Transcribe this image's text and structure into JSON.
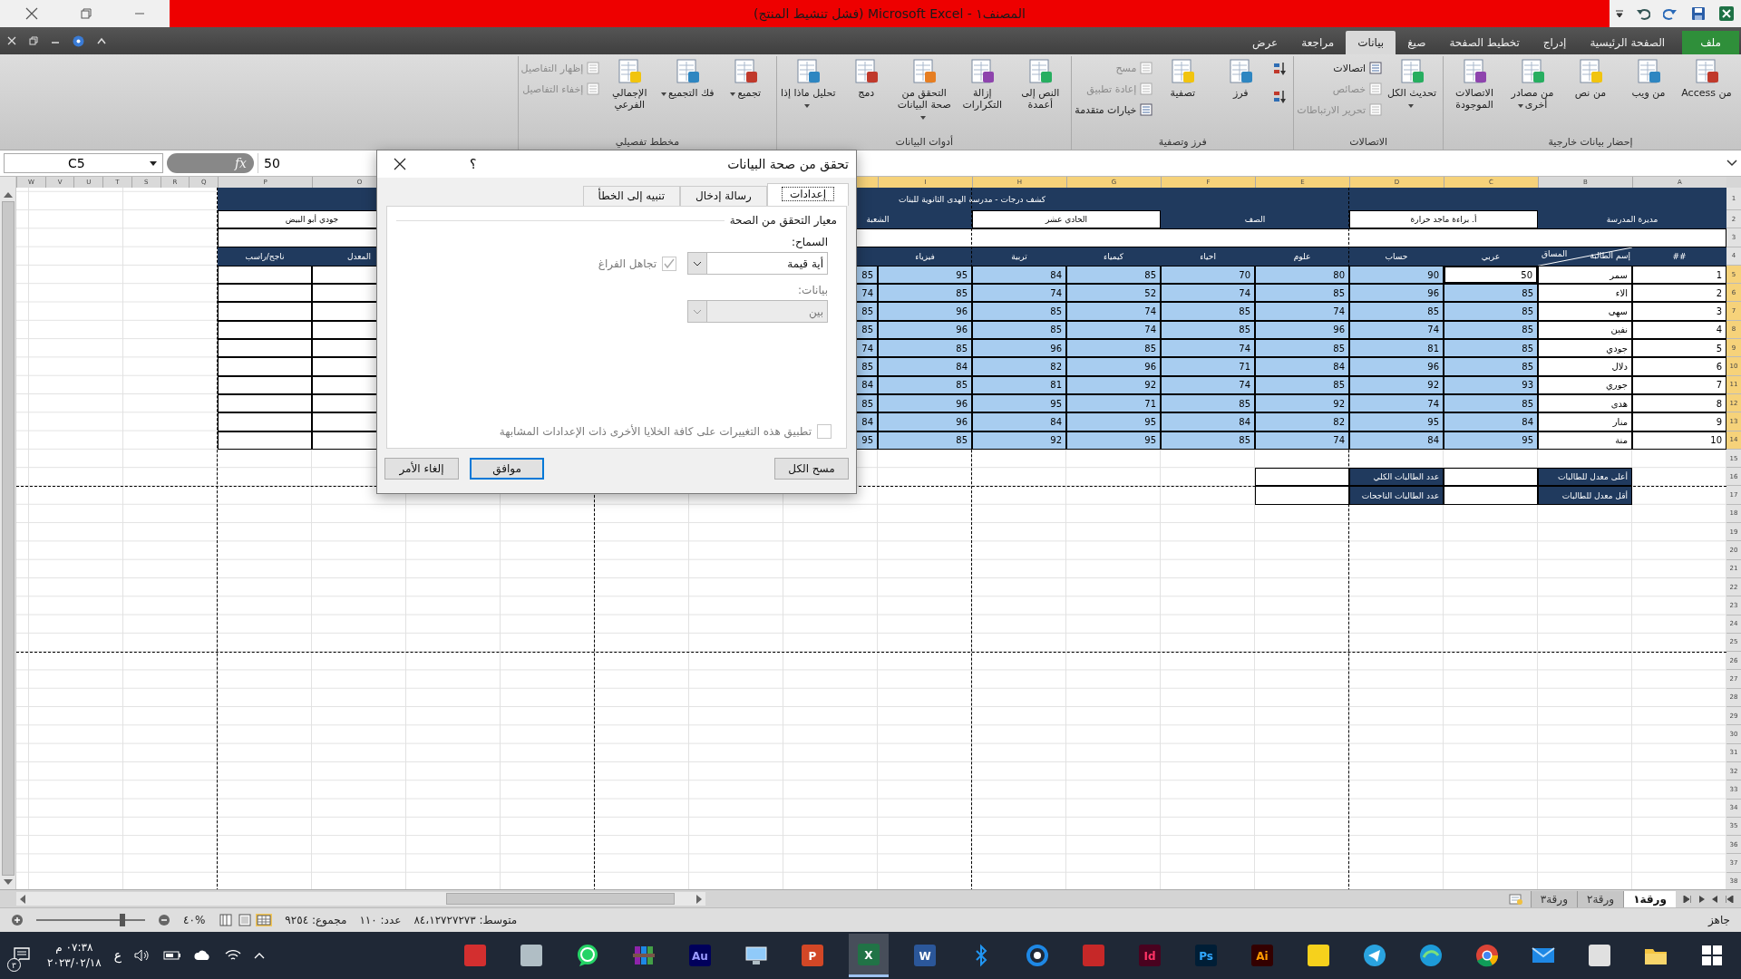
{
  "window": {
    "title": "المصنف١ - Microsoft Excel (فشل تنشيط المنتج)"
  },
  "ribbon_tabs": [
    {
      "label": "ملف",
      "kind": "file",
      "selected": false
    },
    {
      "label": "الصفحة الرئيسية",
      "kind": "tab",
      "selected": false
    },
    {
      "label": "إدراج",
      "kind": "tab",
      "selected": false
    },
    {
      "label": "تخطيط الصفحة",
      "kind": "tab",
      "selected": false
    },
    {
      "label": "صيغ",
      "kind": "tab",
      "selected": false
    },
    {
      "label": "بيانات",
      "kind": "tab",
      "selected": true
    },
    {
      "label": "مراجعة",
      "kind": "tab",
      "selected": false
    },
    {
      "label": "عرض",
      "kind": "tab",
      "selected": false
    }
  ],
  "ribbon_groups": [
    {
      "label": "إحضار بيانات خارجية",
      "buttons": [
        {
          "label": "من Access",
          "kind": "large",
          "dropdown": false,
          "disabled": false
        },
        {
          "label": "من ويب",
          "kind": "large",
          "dropdown": false,
          "disabled": false
        },
        {
          "label": "من نص",
          "kind": "large",
          "dropdown": false,
          "disabled": false
        },
        {
          "label": "من مصادر أخرى",
          "kind": "large",
          "dropdown": true,
          "disabled": false
        },
        {
          "label": "الاتصالات الموجودة",
          "kind": "large",
          "dropdown": false,
          "disabled": false
        }
      ]
    },
    {
      "label": "الاتصالات",
      "buttons": [
        {
          "label": "تحديث الكل",
          "kind": "large",
          "dropdown": true,
          "disabled": false
        },
        {
          "label": "اتصالات",
          "kind": "small",
          "dropdown": false,
          "disabled": false
        },
        {
          "label": "خصائص",
          "kind": "small",
          "dropdown": false,
          "disabled": true
        },
        {
          "label": "تحرير الارتباطات",
          "kind": "small",
          "dropdown": false,
          "disabled": true
        }
      ]
    },
    {
      "label": "فرز وتصفية",
      "buttons": [
        {
          "kind": "icon"
        },
        {
          "kind": "icon"
        },
        {
          "label": "فرز",
          "kind": "large",
          "dropdown": false,
          "disabled": false
        },
        {
          "label": "تصفية",
          "kind": "large",
          "dropdown": false,
          "disabled": false
        },
        {
          "label": "مسح",
          "kind": "small",
          "dropdown": false,
          "disabled": true
        },
        {
          "label": "إعادة تطبيق",
          "kind": "small",
          "dropdown": false,
          "disabled": true
        },
        {
          "label": "خيارات متقدمة",
          "kind": "small",
          "dropdown": false,
          "disabled": false
        }
      ]
    },
    {
      "label": "أدوات البيانات",
      "buttons": [
        {
          "label": "النص إلى أعمدة",
          "kind": "large",
          "dropdown": false,
          "disabled": false
        },
        {
          "label": "إزالة التكرارات",
          "kind": "large",
          "dropdown": false,
          "disabled": false
        },
        {
          "label": "التحقق من صحة البيانات",
          "kind": "large",
          "dropdown": true,
          "disabled": false
        },
        {
          "label": "دمج",
          "kind": "large",
          "dropdown": false,
          "disabled": false
        },
        {
          "label": "تحليل ماذا إذا",
          "kind": "large",
          "dropdown": true,
          "disabled": false
        }
      ]
    },
    {
      "label": "مخطط تفصيلي",
      "buttons": [
        {
          "label": "تجميع",
          "kind": "large",
          "dropdown": true,
          "disabled": false
        },
        {
          "label": "فك التجميع",
          "kind": "large",
          "dropdown": true,
          "disabled": false
        },
        {
          "label": "الإجمالي الفرعي",
          "kind": "large",
          "dropdown": false,
          "disabled": false
        },
        {
          "label": "إظهار التفاصيل",
          "kind": "small",
          "dropdown": false,
          "disabled": true
        },
        {
          "label": "إخفاء التفاصيل",
          "kind": "small",
          "dropdown": false,
          "disabled": true
        }
      ]
    }
  ],
  "formula_bar": {
    "name_box": "C5",
    "function_button": "fx",
    "value": "50"
  },
  "sheet": {
    "columns": [
      {
        "letter": "A",
        "selected": false
      },
      {
        "letter": "B",
        "selected": false
      },
      {
        "letter": "C",
        "selected": true
      },
      {
        "letter": "D",
        "selected": true
      },
      {
        "letter": "E",
        "selected": true
      },
      {
        "letter": "F",
        "selected": true
      },
      {
        "letter": "G",
        "selected": true
      },
      {
        "letter": "H",
        "selected": true
      },
      {
        "letter": "I",
        "selected": true
      },
      {
        "selected": true
      },
      {
        "letter": "O",
        "selected": false
      },
      {
        "letter": "P",
        "selected": false
      },
      {
        "letter": "Q",
        "selected": false
      },
      {
        "letter": "R",
        "selected": false
      },
      {
        "letter": "S",
        "selected": false
      },
      {
        "letter": "T",
        "selected": false
      },
      {
        "letter": "U",
        "selected": false
      },
      {
        "letter": "V",
        "selected": false
      },
      {
        "letter": "W",
        "selected": false
      }
    ],
    "rows": [
      {
        "number": "1",
        "selected": false,
        "cells": [
          {
            "kind": "band"
          },
          {
            "kind": "band",
            "text": "كشف درجات - مدرسة الهدى الثانوية للبنات"
          },
          {
            "kind": "band"
          }
        ]
      },
      {
        "number": "2",
        "selected": false,
        "cells": [
          {
            "kind": "band",
            "text": "مديرة المدرسة"
          },
          {
            "kind": "field",
            "text": "أ. براءة ماجد حرارة"
          },
          {
            "kind": "band",
            "text": "الصف"
          },
          {
            "kind": "field",
            "text": "الحادي عشر"
          },
          {
            "kind": "band",
            "text": "الشعبة"
          },
          {
            "kind": "field",
            "text": "جودي أبو البيض"
          }
        ]
      },
      {
        "number": "3",
        "selected": false,
        "cells": [
          {
            "kind": "field"
          }
        ]
      },
      {
        "number": "4",
        "selected": false,
        "cells": [
          {
            "kind": "band",
            "text": "##"
          },
          {
            "kind": "diag",
            "text": "إسم الطالبة",
            "text2": "المساق"
          },
          {
            "kind": "band",
            "text": "عربي"
          },
          {
            "kind": "band",
            "text": "حساب"
          },
          {
            "kind": "band",
            "text": "علوم"
          },
          {
            "kind": "band",
            "text": "احياء"
          },
          {
            "kind": "band",
            "text": "كيمياء"
          },
          {
            "kind": "band",
            "text": "تربية"
          },
          {
            "kind": "band",
            "text": "فيزياء"
          },
          {
            "kind": "band"
          },
          {
            "kind": "band",
            "text": "المعدل"
          },
          {
            "kind": "band",
            "text": "ناجح/راسب"
          }
        ]
      },
      {
        "number": "5",
        "selected": true,
        "cells": [
          {
            "kind": "index",
            "text": "1"
          },
          {
            "kind": "name",
            "text": "سمر"
          },
          {
            "kind": "value",
            "text": "50",
            "active": true
          },
          {
            "kind": "value",
            "text": "90",
            "selected": true,
            "active": false
          },
          {
            "kind": "value",
            "text": "80",
            "selected": true,
            "active": false
          },
          {
            "kind": "value",
            "text": "70",
            "selected": true,
            "active": false
          },
          {
            "kind": "value",
            "text": "85",
            "selected": true,
            "active": false
          },
          {
            "kind": "value",
            "text": "84",
            "selected": true,
            "active": false
          },
          {
            "kind": "value",
            "text": "95",
            "selected": true,
            "active": false
          },
          {
            "kind": "value",
            "text": "85",
            "selected": true,
            "active": false
          },
          {
            "kind": "field"
          },
          {
            "kind": "field"
          }
        ]
      },
      {
        "number": "6",
        "selected": true,
        "cells": [
          {
            "kind": "index",
            "text": "2"
          },
          {
            "kind": "name",
            "text": "الاء"
          },
          {
            "kind": "value",
            "text": "85",
            "selected": true,
            "active": false
          },
          {
            "kind": "value",
            "text": "96",
            "selected": true,
            "active": false
          },
          {
            "kind": "value",
            "text": "85",
            "selected": true,
            "active": false
          },
          {
            "kind": "value",
            "text": "74",
            "selected": true,
            "active": false
          },
          {
            "kind": "value",
            "text": "52",
            "selected": true,
            "active": false
          },
          {
            "kind": "value",
            "text": "74",
            "selected": true,
            "active": false
          },
          {
            "kind": "value",
            "text": "85",
            "selected": true,
            "active": false
          },
          {
            "kind": "value",
            "text": "74",
            "selected": true,
            "active": false
          },
          {
            "kind": "field"
          },
          {
            "kind": "field"
          }
        ]
      },
      {
        "number": "7",
        "selected": true,
        "cells": [
          {
            "kind": "index",
            "text": "3"
          },
          {
            "kind": "name",
            "text": "سهى"
          },
          {
            "kind": "value",
            "text": "85",
            "selected": true,
            "active": false
          },
          {
            "kind": "value",
            "text": "85",
            "selected": true,
            "active": false
          },
          {
            "kind": "value",
            "text": "74",
            "selected": true,
            "active": false
          },
          {
            "kind": "value",
            "text": "85",
            "selected": true,
            "active": false
          },
          {
            "kind": "value",
            "text": "74",
            "selected": true,
            "active": false
          },
          {
            "kind": "value",
            "text": "85",
            "selected": true,
            "active": false
          },
          {
            "kind": "value",
            "text": "96",
            "selected": true,
            "active": false
          },
          {
            "kind": "value",
            "text": "85",
            "selected": true,
            "active": false
          },
          {
            "kind": "field"
          },
          {
            "kind": "field"
          }
        ]
      },
      {
        "number": "8",
        "selected": true,
        "cells": [
          {
            "kind": "index",
            "text": "4"
          },
          {
            "kind": "name",
            "text": "نفين"
          },
          {
            "kind": "value",
            "text": "85",
            "selected": true,
            "active": false
          },
          {
            "kind": "value",
            "text": "74",
            "selected": true,
            "active": false
          },
          {
            "kind": "value",
            "text": "96",
            "selected": true,
            "active": false
          },
          {
            "kind": "value",
            "text": "85",
            "selected": true,
            "active": false
          },
          {
            "kind": "value",
            "text": "74",
            "selected": true,
            "active": false
          },
          {
            "kind": "value",
            "text": "85",
            "selected": true,
            "active": false
          },
          {
            "kind": "value",
            "text": "96",
            "selected": true,
            "active": false
          },
          {
            "kind": "value",
            "text": "85",
            "selected": true,
            "active": false
          },
          {
            "kind": "field"
          },
          {
            "kind": "field"
          }
        ]
      },
      {
        "number": "9",
        "selected": true,
        "cells": [
          {
            "kind": "index",
            "text": "5"
          },
          {
            "kind": "name",
            "text": "جودي"
          },
          {
            "kind": "value",
            "text": "85",
            "selected": true,
            "active": false
          },
          {
            "kind": "value",
            "text": "81",
            "selected": true,
            "active": false
          },
          {
            "kind": "value",
            "text": "85",
            "selected": true,
            "active": false
          },
          {
            "kind": "value",
            "text": "74",
            "selected": true,
            "active": false
          },
          {
            "kind": "value",
            "text": "85",
            "selected": true,
            "active": false
          },
          {
            "kind": "value",
            "text": "96",
            "selected": true,
            "active": false
          },
          {
            "kind": "value",
            "text": "85",
            "selected": true,
            "active": false
          },
          {
            "kind": "value",
            "text": "74",
            "selected": true,
            "active": false
          },
          {
            "kind": "field"
          },
          {
            "kind": "field"
          }
        ]
      },
      {
        "number": "10",
        "selected": true,
        "cells": [
          {
            "kind": "index",
            "text": "6"
          },
          {
            "kind": "name",
            "text": "دلال"
          },
          {
            "kind": "value",
            "text": "85",
            "selected": true,
            "active": false
          },
          {
            "kind": "value",
            "text": "96",
            "selected": true,
            "active": false
          },
          {
            "kind": "value",
            "text": "84",
            "selected": true,
            "active": false
          },
          {
            "kind": "value",
            "text": "71",
            "selected": true,
            "active": false
          },
          {
            "kind": "value",
            "text": "96",
            "selected": true,
            "active": false
          },
          {
            "kind": "value",
            "text": "82",
            "selected": true,
            "active": false
          },
          {
            "kind": "value",
            "text": "84",
            "selected": true,
            "active": false
          },
          {
            "kind": "value",
            "text": "85",
            "selected": true,
            "active": false
          },
          {
            "kind": "field"
          },
          {
            "kind": "field"
          }
        ]
      },
      {
        "number": "11",
        "selected": true,
        "cells": [
          {
            "kind": "index",
            "text": "7"
          },
          {
            "kind": "name",
            "text": "جوري"
          },
          {
            "kind": "value",
            "text": "93",
            "selected": true,
            "active": false
          },
          {
            "kind": "value",
            "text": "92",
            "selected": true,
            "active": false
          },
          {
            "kind": "value",
            "text": "85",
            "selected": true,
            "active": false
          },
          {
            "kind": "value",
            "text": "74",
            "selected": true,
            "active": false
          },
          {
            "kind": "value",
            "text": "92",
            "selected": true,
            "active": false
          },
          {
            "kind": "value",
            "text": "81",
            "selected": true,
            "active": false
          },
          {
            "kind": "value",
            "text": "85",
            "selected": true,
            "active": false
          },
          {
            "kind": "value",
            "text": "84",
            "selected": true,
            "active": false
          },
          {
            "kind": "field"
          },
          {
            "kind": "field"
          }
        ]
      },
      {
        "number": "12",
        "selected": true,
        "cells": [
          {
            "kind": "index",
            "text": "8"
          },
          {
            "kind": "name",
            "text": "هدى"
          },
          {
            "kind": "value",
            "text": "85",
            "selected": true,
            "active": false
          },
          {
            "kind": "value",
            "text": "74",
            "selected": true,
            "active": false
          },
          {
            "kind": "value",
            "text": "92",
            "selected": true,
            "active": false
          },
          {
            "kind": "value",
            "text": "85",
            "selected": true,
            "active": false
          },
          {
            "kind": "value",
            "text": "71",
            "selected": true,
            "active": false
          },
          {
            "kind": "value",
            "text": "95",
            "selected": true,
            "active": false
          },
          {
            "kind": "value",
            "text": "96",
            "selected": true,
            "active": false
          },
          {
            "kind": "value",
            "text": "85",
            "selected": true,
            "active": false
          },
          {
            "kind": "field"
          },
          {
            "kind": "field"
          }
        ]
      },
      {
        "number": "13",
        "selected": true,
        "cells": [
          {
            "kind": "index",
            "text": "9"
          },
          {
            "kind": "name",
            "text": "منار"
          },
          {
            "kind": "value",
            "text": "84",
            "selected": true,
            "active": false
          },
          {
            "kind": "value",
            "text": "95",
            "selected": true,
            "active": false
          },
          {
            "kind": "value",
            "text": "82",
            "selected": true,
            "active": false
          },
          {
            "kind": "value",
            "text": "84",
            "selected": true,
            "active": false
          },
          {
            "kind": "value",
            "text": "95",
            "selected": true,
            "active": false
          },
          {
            "kind": "value",
            "text": "84",
            "selected": true,
            "active": false
          },
          {
            "kind": "value",
            "text": "96",
            "selected": true,
            "active": false
          },
          {
            "kind": "value",
            "text": "84",
            "selected": true,
            "active": false
          },
          {
            "kind": "field"
          },
          {
            "kind": "field"
          }
        ]
      },
      {
        "number": "14",
        "selected": true,
        "cells": [
          {
            "kind": "index",
            "text": "10"
          },
          {
            "kind": "name",
            "text": "منة"
          },
          {
            "kind": "value",
            "text": "95",
            "selected": true,
            "active": false
          },
          {
            "kind": "value",
            "text": "84",
            "selected": true,
            "active": false
          },
          {
            "kind": "value",
            "text": "74",
            "selected": true,
            "active": false
          },
          {
            "kind": "value",
            "text": "85",
            "selected": true,
            "active": false
          },
          {
            "kind": "value",
            "text": "95",
            "selected": true,
            "active": false
          },
          {
            "kind": "value",
            "text": "92",
            "selected": true,
            "active": false
          },
          {
            "kind": "value",
            "text": "85",
            "selected": true,
            "active": false
          },
          {
            "kind": "value",
            "text": "95",
            "selected": true,
            "active": false
          },
          {
            "kind": "field"
          },
          {
            "kind": "field"
          }
        ]
      },
      {
        "number": "15",
        "selected": false
      },
      {
        "number": "16",
        "selected": false,
        "cells": [
          {
            "kind": "plain"
          },
          {
            "kind": "summary",
            "text": "أعلى معدل للطالبات"
          },
          {
            "kind": "field"
          },
          {
            "kind": "summary",
            "text": "عدد الطالبات الكلي"
          },
          {
            "kind": "field"
          }
        ]
      },
      {
        "number": "17",
        "selected": false,
        "cells": [
          {
            "kind": "plain"
          },
          {
            "kind": "summary",
            "text": "أقل معدل للطالبات"
          },
          {
            "kind": "field"
          },
          {
            "kind": "summary",
            "text": "عدد الطالبات الناجحات"
          },
          {
            "kind": "field"
          }
        ]
      },
      {
        "number": "18",
        "selected": false
      },
      {
        "number": "19",
        "selected": false
      },
      {
        "number": "20",
        "selected": false
      },
      {
        "number": "21",
        "selected": false
      },
      {
        "number": "22",
        "selected": false
      },
      {
        "number": "23",
        "selected": false
      },
      {
        "number": "24",
        "selected": false
      },
      {
        "number": "25",
        "selected": false
      },
      {
        "number": "26",
        "selected": false
      },
      {
        "number": "27",
        "selected": false
      },
      {
        "number": "28",
        "selected": false
      },
      {
        "number": "29",
        "selected": false
      },
      {
        "number": "30",
        "selected": false
      },
      {
        "number": "31",
        "selected": false
      },
      {
        "number": "32",
        "selected": false
      },
      {
        "number": "33",
        "selected": false
      },
      {
        "number": "34",
        "selected": false
      },
      {
        "number": "35",
        "selected": false
      },
      {
        "number": "36",
        "selected": false
      },
      {
        "number": "37",
        "selected": false
      },
      {
        "number": "38",
        "selected": false
      }
    ]
  },
  "dialog": {
    "title": "تحقق من صحة البيانات",
    "help": "؟",
    "tabs": [
      {
        "label": "إعدادات",
        "selected": true
      },
      {
        "label": "رسالة إدخال",
        "selected": false
      },
      {
        "label": "تنبيه إلى الخطأ",
        "selected": false
      }
    ],
    "section": "معيار التحقق من الصحة",
    "allow_label": "السماح:",
    "allow_value": "أية قيمة",
    "ignore_blank": {
      "label": "تجاهل الفراغ",
      "checked": true,
      "disabled": true
    },
    "data_label": "بيانات:",
    "data_value": "بين",
    "data_disabled": true,
    "apply_all": {
      "label": "تطبيق هذه التغييرات على كافة الخلايا الأخرى ذات الإعدادات المشابهة",
      "checked": false,
      "disabled": true
    },
    "buttons": [
      {
        "label": "مسح الكل",
        "kind": "normal"
      },
      {
        "label": "موافق",
        "kind": "default"
      },
      {
        "label": "إلغاء الأمر",
        "kind": "normal"
      }
    ]
  },
  "sheet_tabs": [
    {
      "label": "ورقة١",
      "selected": true
    },
    {
      "label": "ورقة٢",
      "selected": false
    },
    {
      "label": "ورقة٣",
      "selected": false
    }
  ],
  "status_bar": {
    "ready": "جاهز",
    "average": "متوسط: ٨٤،١٢٧٢٧٢٧٣",
    "count": "عدد: ١١٠",
    "sum": "مجموع: ٩٢٥٤",
    "zoom": "%٤٠"
  },
  "taskbar": {
    "apps": [
      {
        "kind": "start",
        "selected": false
      },
      {
        "kind": "folder",
        "selected": false
      },
      {
        "kind": "bag",
        "selected": false
      },
      {
        "kind": "mail",
        "selected": false
      },
      {
        "kind": "round",
        "selected": false
      },
      {
        "kind": "wave",
        "selected": false
      },
      {
        "kind": "plane",
        "selected": false
      },
      {
        "kind": "note",
        "selected": false
      },
      {
        "kind": "ai",
        "label": "Ai",
        "selected": false
      },
      {
        "kind": "ps",
        "label": "Ps",
        "selected": false
      },
      {
        "kind": "id",
        "label": "Id",
        "selected": false
      },
      {
        "kind": "red",
        "selected": false
      },
      {
        "kind": "ring",
        "selected": false
      },
      {
        "kind": "bt",
        "selected": false
      },
      {
        "kind": "word",
        "label": "W",
        "selected": false
      },
      {
        "kind": "excel",
        "label": "X",
        "selected": true
      },
      {
        "kind": "ppt",
        "label": "P",
        "selected": false
      },
      {
        "kind": "monitor",
        "selected": false
      },
      {
        "kind": "au",
        "label": "Au",
        "selected": false
      },
      {
        "kind": "books",
        "selected": false
      },
      {
        "kind": "chat",
        "selected": false
      },
      {
        "kind": "capture",
        "selected": false
      },
      {
        "kind": "pdf",
        "selected": false
      }
    ],
    "language": "ع",
    "time": "٠٧:٣٨ م",
    "date": "٢٠٢٣/٠٢/١٨",
    "notifications": "٣"
  }
}
